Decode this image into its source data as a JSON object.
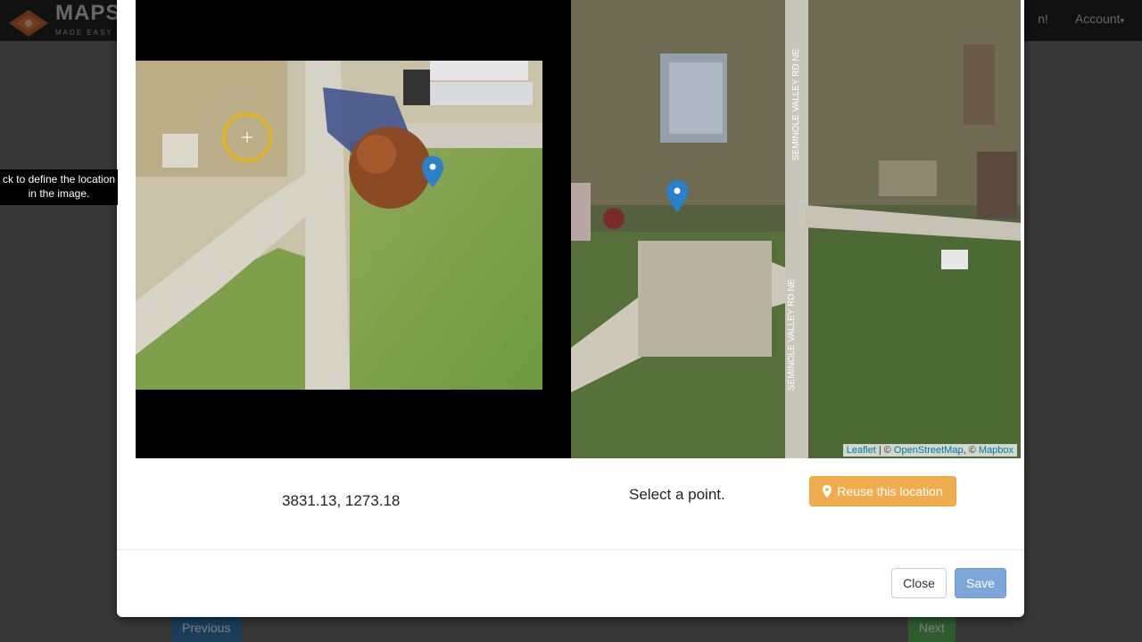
{
  "app": {
    "brand_title": "MAPS",
    "brand_subtitle": "MADE EASY",
    "nav_partial": "n!",
    "account_label": "Account"
  },
  "background": {
    "previous_label": "Previous",
    "next_label": "Next",
    "tooltip_text": "ck to define the location in the image."
  },
  "modal": {
    "image_coordinates": "3831.13, 1273.18",
    "status_text": "Select a point.",
    "reuse_button_label": "Reuse this location",
    "close_label": "Close",
    "save_label": "Save",
    "map": {
      "road_label": "SEMINOLE VALLEY RD NE",
      "attribution": {
        "leaflet": "Leaflet",
        "separator1": " | © ",
        "osm": "OpenStreetMap",
        "separator2": ", © ",
        "mapbox": "Mapbox"
      }
    }
  },
  "icons": {
    "logo": "maps-made-easy-logo",
    "marker": "map-marker-icon",
    "crosshair": "crosshair-target-icon"
  },
  "colors": {
    "warning": "#f0ad4e",
    "primary_disabled": "#7da7d9",
    "marker": "#2a81cb",
    "target_ring": "#e3b124",
    "prev_button": "#337ab7",
    "next_button": "#5cb85c"
  }
}
